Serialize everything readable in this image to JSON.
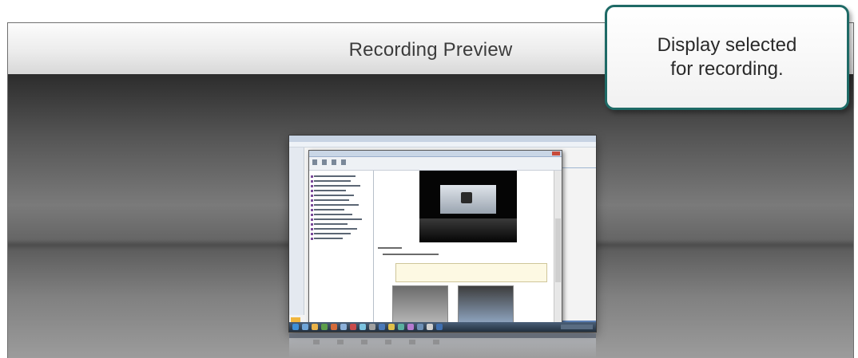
{
  "window": {
    "title": "Recording Preview"
  },
  "callout": {
    "text": "Display selected\nfor recording."
  },
  "colors": {
    "callout_border": "#1e6a66",
    "title_bar_top": "#fcfcfc",
    "stage_dark": "#2c2c2c",
    "stage_light": "#9c9c9c"
  },
  "preview": {
    "monitor_icon": "display-thumbnail",
    "taskbar_icon": "windows-taskbar"
  }
}
